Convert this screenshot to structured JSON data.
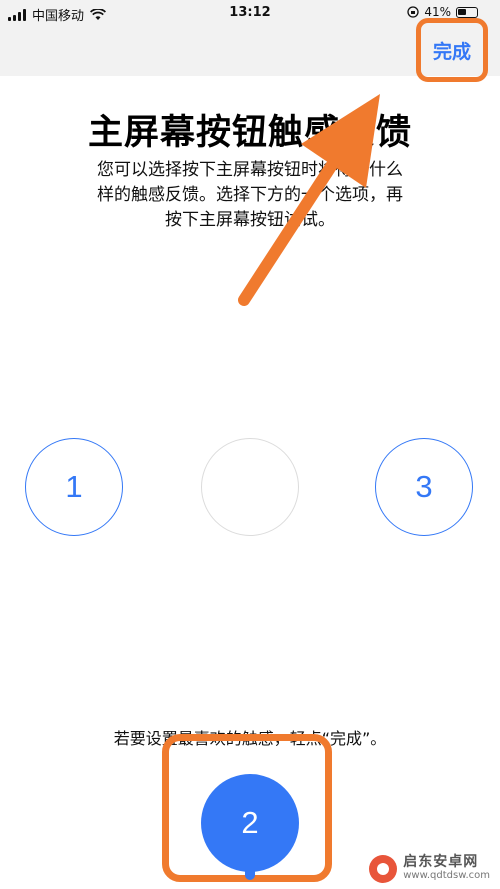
{
  "status_bar": {
    "carrier": "中国移动",
    "time": "13:12",
    "battery_percent": "41%"
  },
  "nav": {
    "done_label": "完成"
  },
  "title": "主屏幕按钮触感反馈",
  "description": [
    "您可以选择按下主屏幕按钮时将得到什么",
    "样的触感反馈。选择下方的一个选项，再",
    "按下主屏幕按钮试试。"
  ],
  "options": [
    "1",
    "2",
    "3"
  ],
  "selected_option": "2",
  "hint": "若要设置最喜欢的触感，轻点“完成”。",
  "watermark": {
    "name": "启东安卓网",
    "url": "www.qdtdsw.com"
  },
  "colors": {
    "accent": "#3478f6",
    "annotation": "#f07a2e"
  },
  "icons": [
    "signal-icon",
    "wifi-icon",
    "lock-rotation-icon",
    "battery-icon",
    "arrow-annotation-icon"
  ]
}
